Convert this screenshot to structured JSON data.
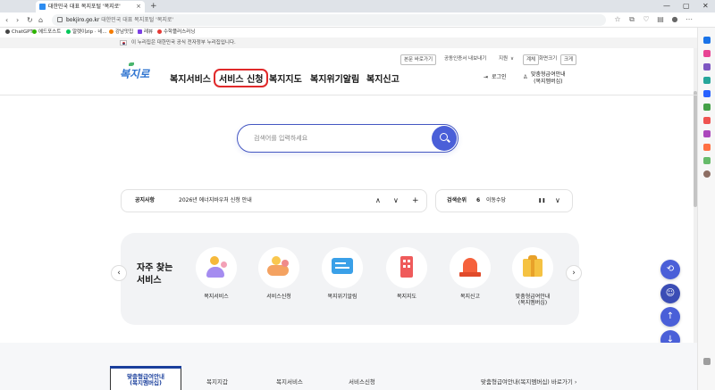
{
  "browser": {
    "tab_title": "대한민국 대표 복지포털 '복지로'",
    "tab_close": "×",
    "new_tab": "+",
    "window_controls": [
      "—",
      "▢",
      "✕"
    ],
    "nav": [
      "‹",
      "›",
      "↻",
      "⌂"
    ],
    "url_host": "bokjiro.go.kr",
    "url_title": "대한민국 대표 복지포털 '복지로'",
    "bookmarks": [
      {
        "label": "ChatGPT",
        "color": "#444"
      },
      {
        "label": "에드포스트",
        "color": "#2db400"
      },
      {
        "label": "알렛이zip · 네...",
        "color": "#03c75a"
      },
      {
        "label": "강남맛집",
        "color": "#f57c00"
      },
      {
        "label": "레뷰",
        "color": "#7b3fe4"
      },
      {
        "label": "수학플러스러닝",
        "color": "#e53935"
      }
    ]
  },
  "gov_banner": "이 누리집은 대한민국 공식 전자정부 누리집입니다.",
  "header": {
    "util": {
      "skip_to_body": "본문 바로가기",
      "cert": "공동인증서 내보내기",
      "support": "지원",
      "text_size": "계체",
      "zoom": "화면크기",
      "zoom_value": "크게"
    },
    "logo": "복지로",
    "menu": [
      "복지서비스",
      "서비스 신청",
      "복지지도",
      "복지위기알림",
      "복지신고"
    ],
    "highlighted_menu": "서비스 신청",
    "login": "로그인",
    "benefit": {
      "line1": "맞춤형급여안내",
      "line2": "(복지멤버십)"
    }
  },
  "search": {
    "placeholder": "검색어를 입력하세요"
  },
  "notice": {
    "label": "공지사항",
    "text": "2026년 에너지바우처 신청 안내",
    "controls": [
      "∧",
      "∨",
      "+"
    ]
  },
  "ranking": {
    "label": "검색순위",
    "rank": "6",
    "keyword": "이동수당",
    "controls": [
      "❚❚",
      "∨"
    ]
  },
  "frequent": {
    "title_line1": "자주 찾는",
    "title_line2": "서비스",
    "prev": "‹",
    "next": "›",
    "items": [
      {
        "label": "복지서비스",
        "icon": "people-icon"
      },
      {
        "label": "서비스신청",
        "icon": "hand-coin-icon"
      },
      {
        "label": "복지위기알림",
        "icon": "message-icon"
      },
      {
        "label": "복지지도",
        "icon": "building-icon"
      },
      {
        "label": "복지신고",
        "icon": "siren-icon"
      },
      {
        "label": "맞춤형급여안내\n(복지멤버십)",
        "icon": "gift-box-icon"
      }
    ]
  },
  "floating": [
    "⟲",
    "☺",
    "↑",
    "↓"
  ],
  "bottom_tabs": {
    "active": "맞춤형급여안내\n(복지멤버십)",
    "tabs": [
      "복지지갑",
      "복지서비스",
      "서비스신청"
    ],
    "link": "맞춤형급여안내(복지멤버십) 바로가기 ›"
  },
  "colors": {
    "accent": "#4a5fd8",
    "highlight_border": "#e0292a",
    "logo": "#2f74d0"
  }
}
